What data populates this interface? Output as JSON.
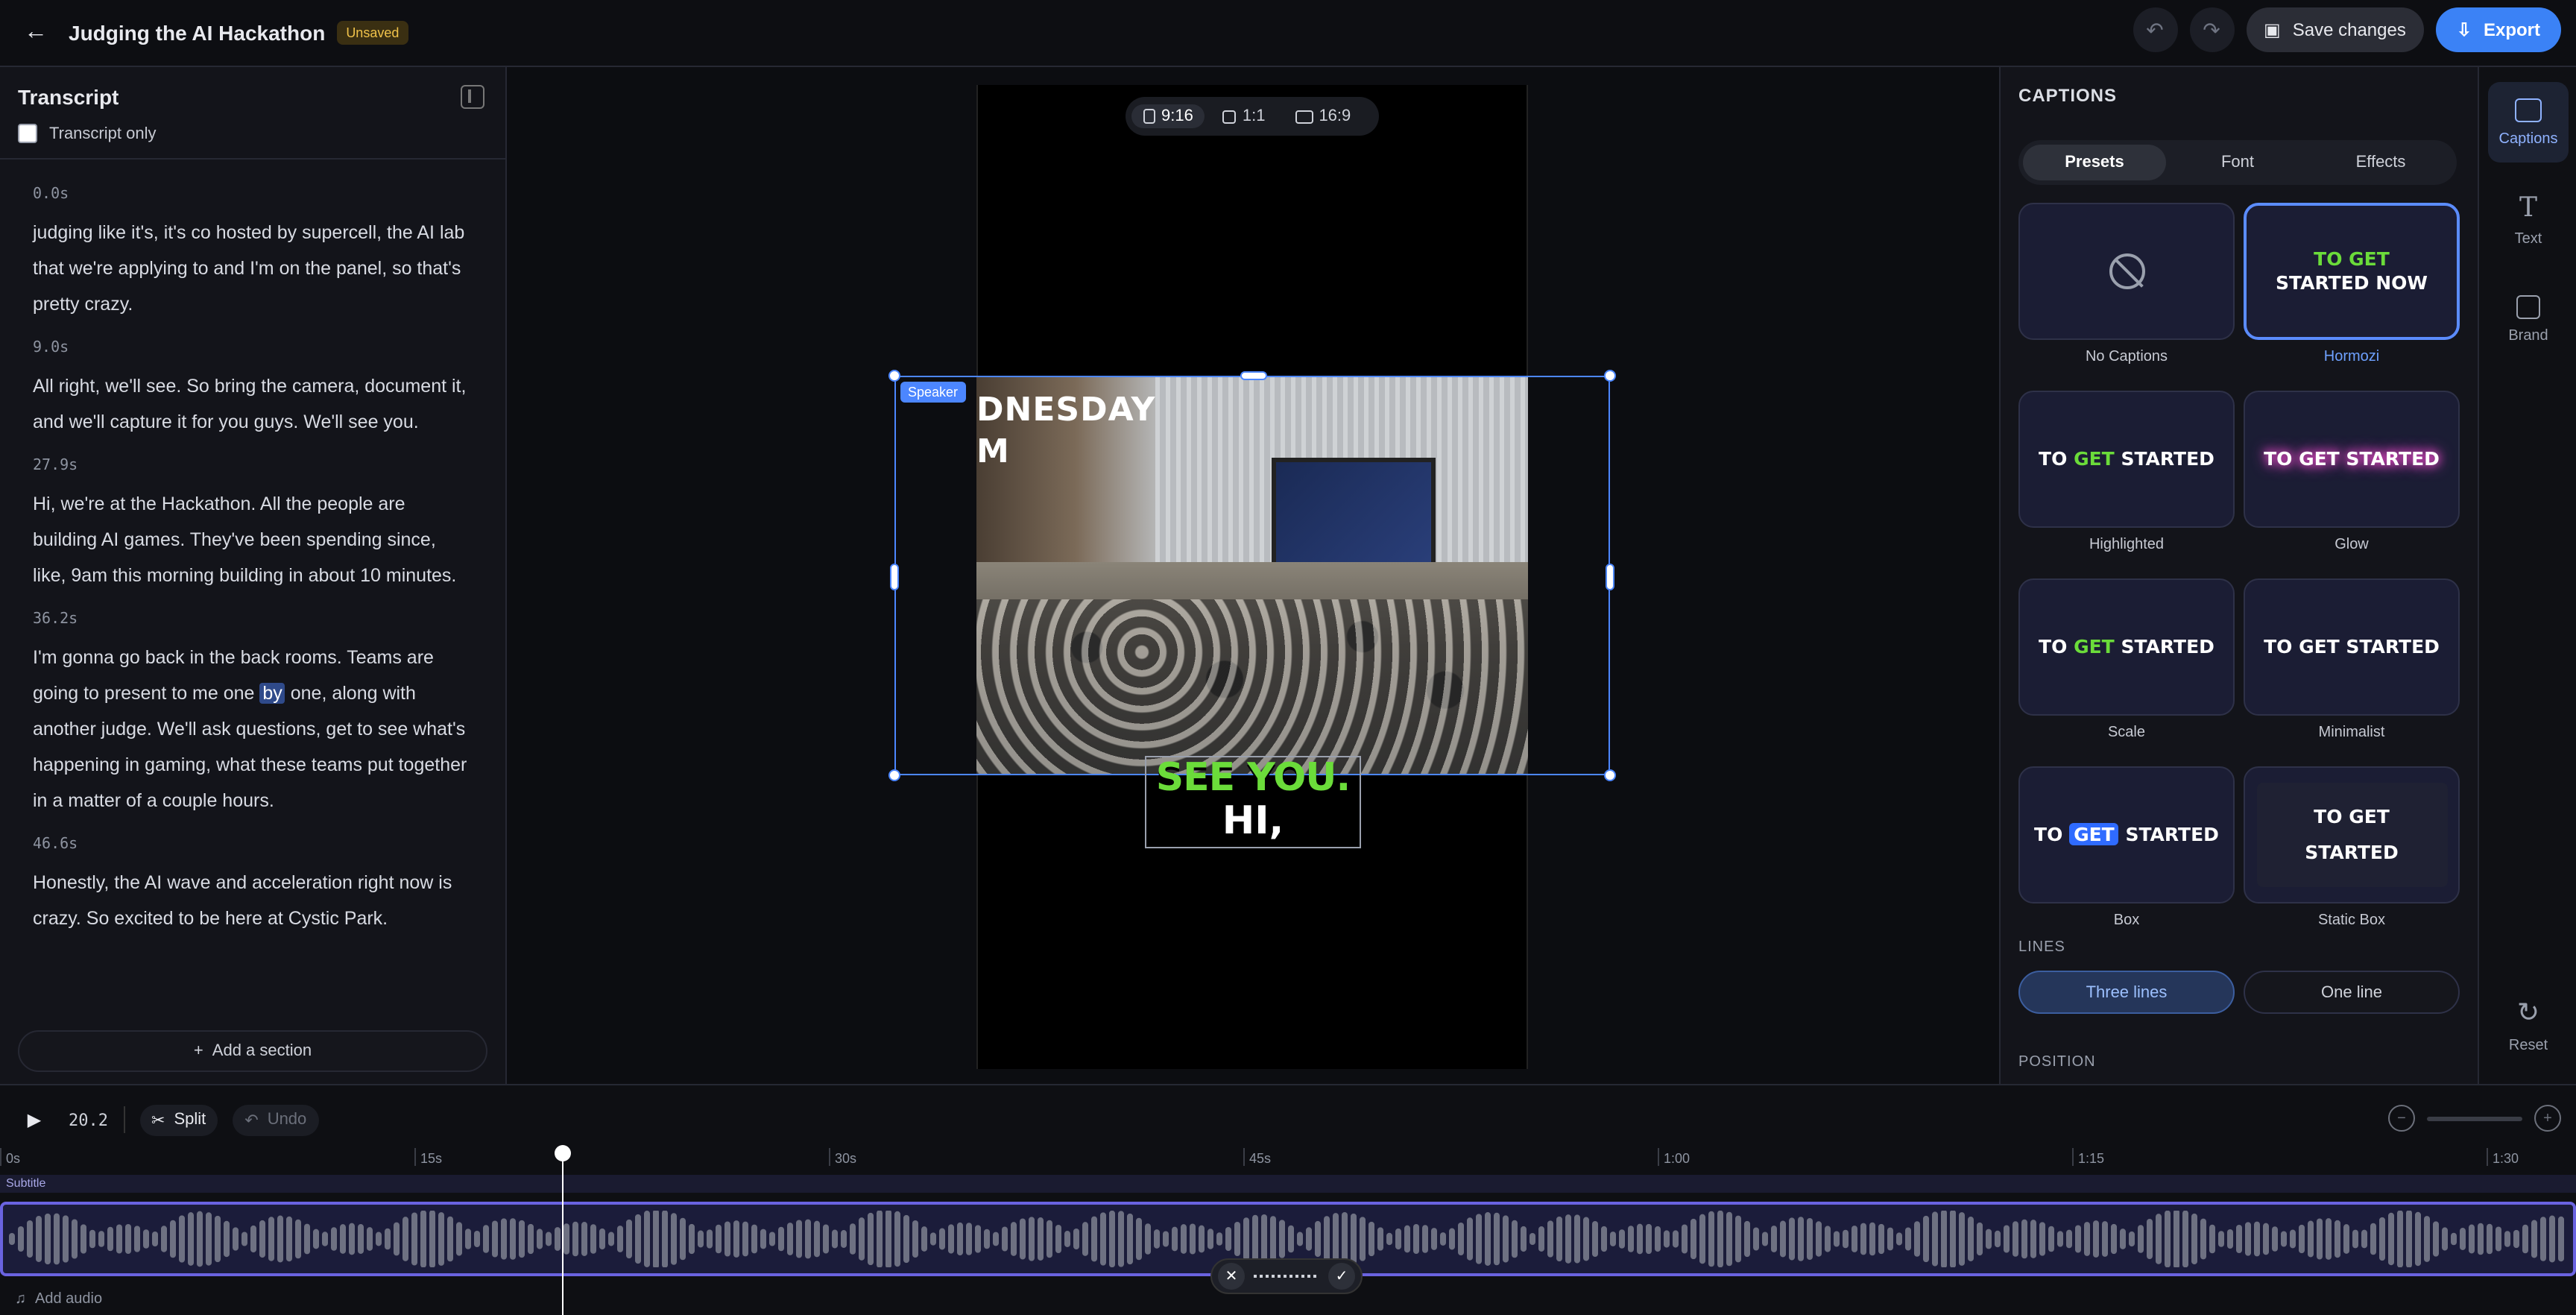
{
  "header": {
    "title": "Judging the AI Hackathon",
    "badge": "Unsaved",
    "save_label": "Save changes",
    "export_label": "Export"
  },
  "transcript": {
    "title": "Transcript",
    "toggle_label": "Transcript only",
    "segments": [
      {
        "time": "0.0s",
        "text": "judging like it's, it's co hosted by supercell, the AI lab that we're applying to and I'm on the panel, so that's pretty crazy."
      },
      {
        "time": "9.0s",
        "text": "All right, we'll see. So bring the camera, document it, and we'll capture it for you guys. We'll see you."
      },
      {
        "time": "27.9s",
        "text": "Hi, we're at the Hackathon. All the people are building AI games. They've been spending since, like, 9am this morning building in about 10 minutes."
      },
      {
        "time": "36.2s",
        "text_before": "I'm gonna go back in the back rooms. Teams are going to present to me one ",
        "highlight": "by",
        "text_after": " one, along with another judge. We'll ask questions, get to see what's happening in gaming, what these teams put together in a matter of a couple hours."
      },
      {
        "time": "46.6s",
        "text": "Honestly, the AI wave and acceleration right now is crazy. So excited to be here at Cystic Park."
      }
    ],
    "add_section_label": "Add a section"
  },
  "preview": {
    "aspect_options": [
      "9:16",
      "1:1",
      "16:9"
    ],
    "speaker_label": "Speaker",
    "overlay_lines": [
      "DNESDAY",
      "M"
    ],
    "caption_line1": "SEE YOU.",
    "caption_line2": "HI,"
  },
  "captions": {
    "title": "CAPTIONS",
    "tabs": [
      "Presets",
      "Font",
      "Effects"
    ],
    "presets": {
      "no_captions": "No Captions",
      "hormozi": "Hormozi",
      "hormozi_text_1": "TO GET",
      "hormozi_text_2": "STARTED NOW",
      "highlighted": "Highlighted",
      "glow": "Glow",
      "scale": "Scale",
      "minimalist": "Minimalist",
      "box": "Box",
      "static_box": "Static Box",
      "sample_to": "TO",
      "sample_get": "GET",
      "sample_started": "STARTED",
      "sample_full": "TO GET STARTED"
    },
    "lines_title": "LINES",
    "lines_options": [
      "Three lines",
      "One line"
    ],
    "position_title": "POSITION"
  },
  "rail": {
    "captions": "Captions",
    "text": "Text",
    "brand": "Brand",
    "reset": "Reset"
  },
  "timeline": {
    "time": "20.2",
    "split_label": "Split",
    "undo_label": "Undo",
    "ticks": [
      "0s",
      "15s",
      "30s",
      "45s",
      "1:00",
      "1:15",
      "1:30"
    ],
    "subtitle_track": "Subtitle",
    "add_audio": "Add audio"
  },
  "colors": {
    "accent": "#3b82f6",
    "caption_green": "#6bdc3a",
    "glow_pink": "#ff4fd8"
  }
}
